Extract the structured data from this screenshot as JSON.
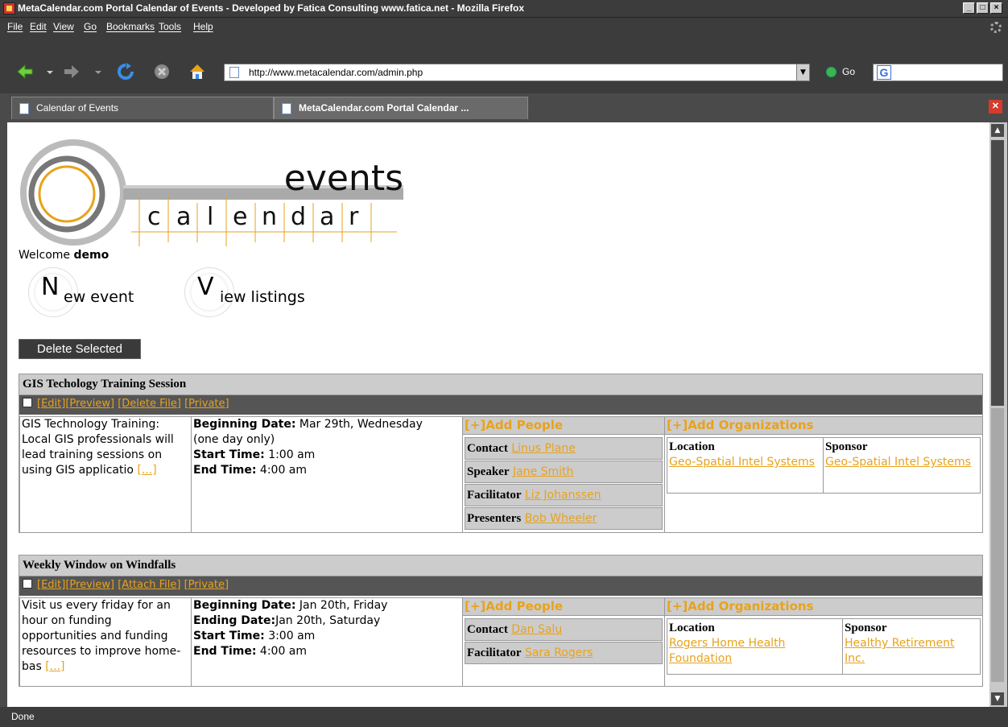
{
  "window": {
    "title": "MetaCalendar.com Portal Calendar of Events - Developed by Fatica Consulting www.fatica.net - Mozilla Firefox"
  },
  "menu": [
    "File",
    "Edit",
    "View",
    "Go",
    "Bookmarks",
    "Tools",
    "Help"
  ],
  "nav": {
    "url": "http://www.metacalendar.com/admin.php",
    "go_label": "Go"
  },
  "tabs": [
    {
      "label": "Calendar of Events"
    },
    {
      "label": "MetaCalendar.com Portal Calendar ..."
    }
  ],
  "status": "Done",
  "page": {
    "logo": {
      "word1": "events",
      "letters": [
        "c",
        "a",
        "l",
        "e",
        "n",
        "d",
        "a",
        "r"
      ]
    },
    "welcome_prefix": "Welcome ",
    "user": "demo",
    "new_event": {
      "big": "N",
      "rest": "ew event"
    },
    "view_listings": {
      "big": "V",
      "rest": "iew listings"
    },
    "delete_selected": "Delete Selected",
    "add_people": "[+]Add People",
    "add_orgs": "[+]Add Organizations",
    "events": [
      {
        "title": "GIS Techology Training Session",
        "actions": [
          "[Edit]",
          "[Preview]",
          "[Delete File]",
          "[Private]"
        ],
        "desc": "GIS Technology Training: Local GIS professionals will lead training sessions on using GIS applicatio",
        "more": "[...]",
        "dates": [
          {
            "label": "Beginning Date:",
            "value": "Mar 29th, Wednesday"
          },
          {
            "label": "",
            "value": "(one day only)"
          },
          {
            "label": "Start Time:",
            "value": "1:00 am"
          },
          {
            "label": "End Time:",
            "value": "4:00 am"
          }
        ],
        "people": [
          {
            "role": "Contact",
            "name": "Linus Plane"
          },
          {
            "role": "Speaker",
            "name": "Jane Smith"
          },
          {
            "role": "Facilitator",
            "name": "Liz Johanssen"
          },
          {
            "role": "Presenters",
            "name": "Bob Wheeler"
          }
        ],
        "orgs": [
          {
            "role": "Location",
            "name": "Geo-Spatial Intel Systems"
          },
          {
            "role": "Sponsor",
            "name": "Geo-Spatial Intel Systems"
          }
        ]
      },
      {
        "title": "Weekly Window on Windfalls",
        "actions": [
          "[Edit]",
          "[Preview]",
          "[Attach File]",
          "[Private]"
        ],
        "desc": "Visit us every friday for an hour on funding opportunities and funding resources to improve home-bas",
        "more": "[...]",
        "dates": [
          {
            "label": "Beginning Date:",
            "value": "Jan 20th, Friday"
          },
          {
            "label": "Ending Date:",
            "value": "Jan 20th, Saturday"
          },
          {
            "label": "Start Time:",
            "value": "3:00 am"
          },
          {
            "label": "End Time:",
            "value": "4:00 am"
          }
        ],
        "people": [
          {
            "role": "Contact",
            "name": "Dan Salu"
          },
          {
            "role": "Facilitator",
            "name": "Sara Rogers"
          }
        ],
        "orgs": [
          {
            "role": "Location",
            "name": "Rogers Home Health Foundation"
          },
          {
            "role": "Sponsor",
            "name": "Healthy Retirement Inc."
          }
        ]
      }
    ]
  }
}
